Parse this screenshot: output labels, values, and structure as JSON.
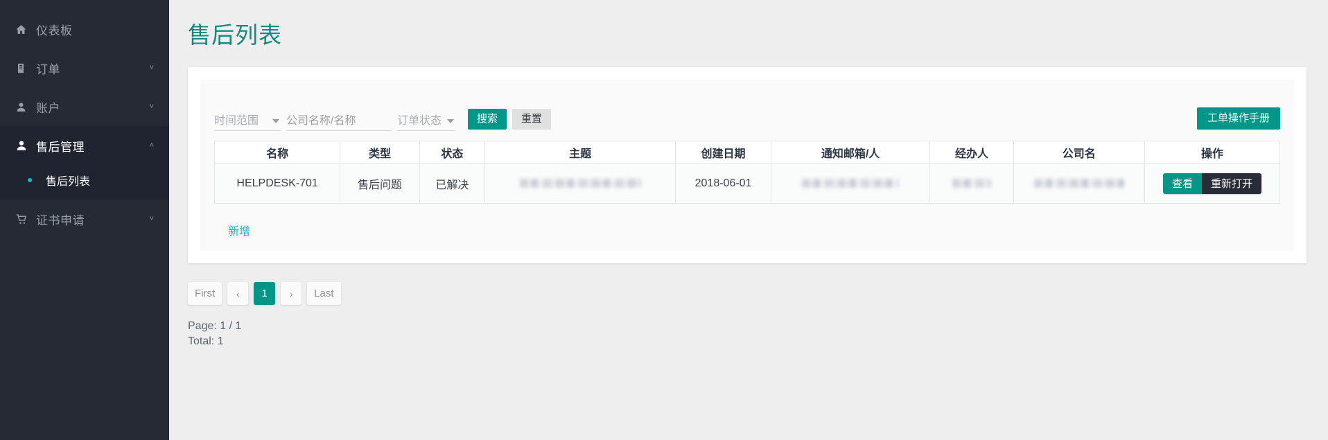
{
  "theme": {
    "accent_teal": "#009688",
    "title_teal": "#138a80",
    "link_cyan": "#00b4d8",
    "sidebar_bg": "#252a34",
    "sidebar_active_bg": "#1f2430",
    "dark_button": "#272c36",
    "page_bg": "#eeeeee"
  },
  "sidebar": {
    "items": [
      {
        "label": "仪表板",
        "icon": "home-icon",
        "has_chevron": false,
        "expanded": false,
        "active": false
      },
      {
        "label": "订单",
        "icon": "clipboard-icon",
        "has_chevron": true,
        "chevron": "˅",
        "expanded": false,
        "active": false
      },
      {
        "label": "账户",
        "icon": "user-icon",
        "has_chevron": true,
        "chevron": "˅",
        "expanded": false,
        "active": false
      },
      {
        "label": "售后管理",
        "icon": "user-icon",
        "has_chevron": true,
        "chevron": "˄",
        "expanded": true,
        "active": true
      },
      {
        "label": "证书申请",
        "icon": "cart-icon",
        "has_chevron": true,
        "chevron": "˅",
        "expanded": false,
        "active": false
      }
    ],
    "submenu": [
      {
        "label": "售后列表",
        "active": true
      }
    ]
  },
  "page": {
    "title": "售后列表"
  },
  "filters": {
    "date_range": {
      "label": "时间范围",
      "value": "",
      "icon": "chevron-down-icon"
    },
    "company_name": {
      "placeholder": "公司名称/名称",
      "value": ""
    },
    "order_status": {
      "label": "订单状态",
      "value": "",
      "icon": "chevron-down-icon"
    },
    "search_label": "搜索",
    "reset_label": "重置",
    "manual_label": "工单操作手册"
  },
  "table": {
    "headers": [
      "名称",
      "类型",
      "状态",
      "主题",
      "创建日期",
      "通知邮箱/人",
      "经办人",
      "公司名",
      "操作"
    ],
    "rows": [
      {
        "name": "HELPDESK-701",
        "type": "售后问题",
        "status": "已解决",
        "subject": "",
        "subject_redacted": true,
        "created_date": "2018-06-01",
        "notify": "",
        "notify_redacted": true,
        "agent": "",
        "agent_redacted": true,
        "company": "",
        "company_redacted": true,
        "actions": {
          "view": "查看",
          "reopen": "重新打开"
        }
      }
    ],
    "add_label": "新增"
  },
  "pagination": {
    "first": "First",
    "prev": "‹",
    "pages": [
      {
        "label": "1",
        "active": true
      }
    ],
    "next": "›",
    "last": "Last",
    "page_info": "Page: 1 / 1",
    "total_info": "Total: 1"
  }
}
